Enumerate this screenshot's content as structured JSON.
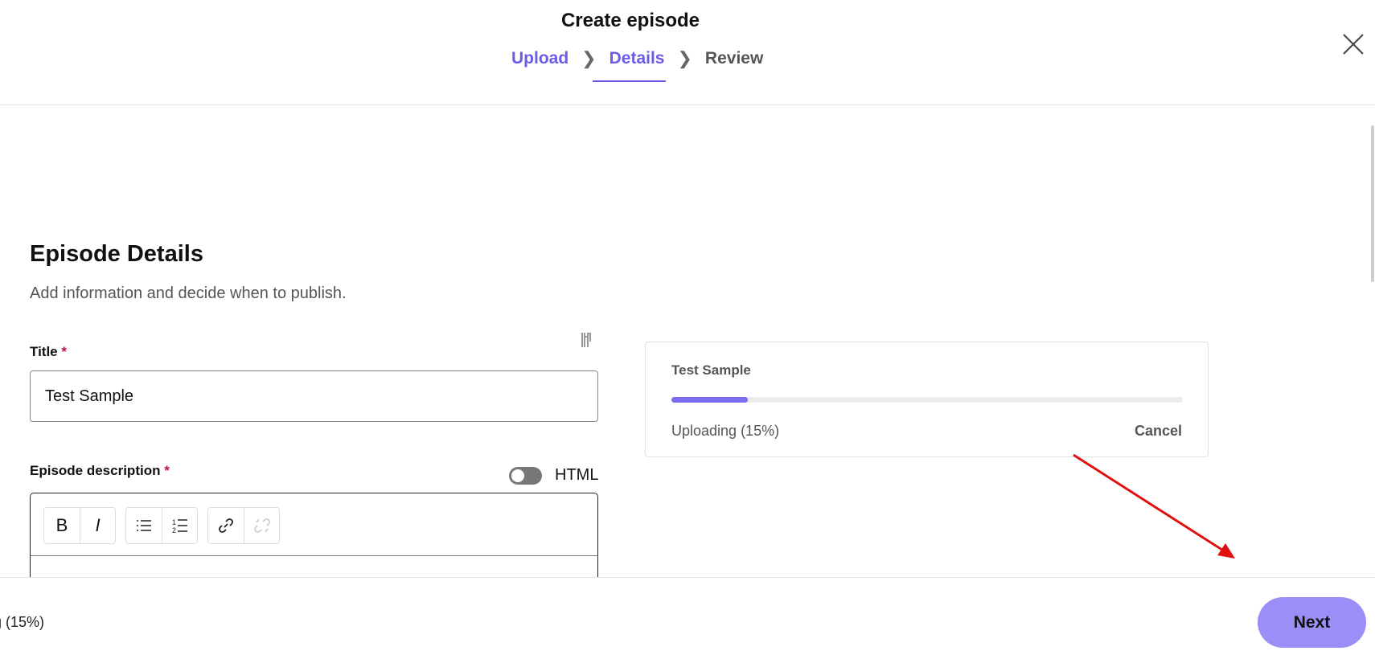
{
  "header": {
    "title": "Create episode",
    "steps": [
      {
        "label": "Upload",
        "state": "done"
      },
      {
        "label": "Details",
        "state": "active"
      },
      {
        "label": "Review",
        "state": "pending"
      }
    ]
  },
  "page": {
    "heading": "Episode Details",
    "subtitle": "Add information and decide when to publish."
  },
  "form": {
    "title_label": "Title",
    "required_mark": "*",
    "title_value": "Test Sample",
    "description_label": "Episode description",
    "html_toggle_label": "HTML",
    "html_toggle_on": false,
    "toolbar": {
      "bold": "B",
      "italic": "I"
    }
  },
  "upload_card": {
    "title": "Test Sample",
    "status": "Uploading (15%)",
    "progress_percent": 15,
    "cancel_label": "Cancel"
  },
  "footer": {
    "status": "g (15%)",
    "next_label": "Next"
  },
  "colors": {
    "accent": "#6b5ce7",
    "next_button": "#9b8ff7",
    "annotation_arrow": "#e01010"
  }
}
